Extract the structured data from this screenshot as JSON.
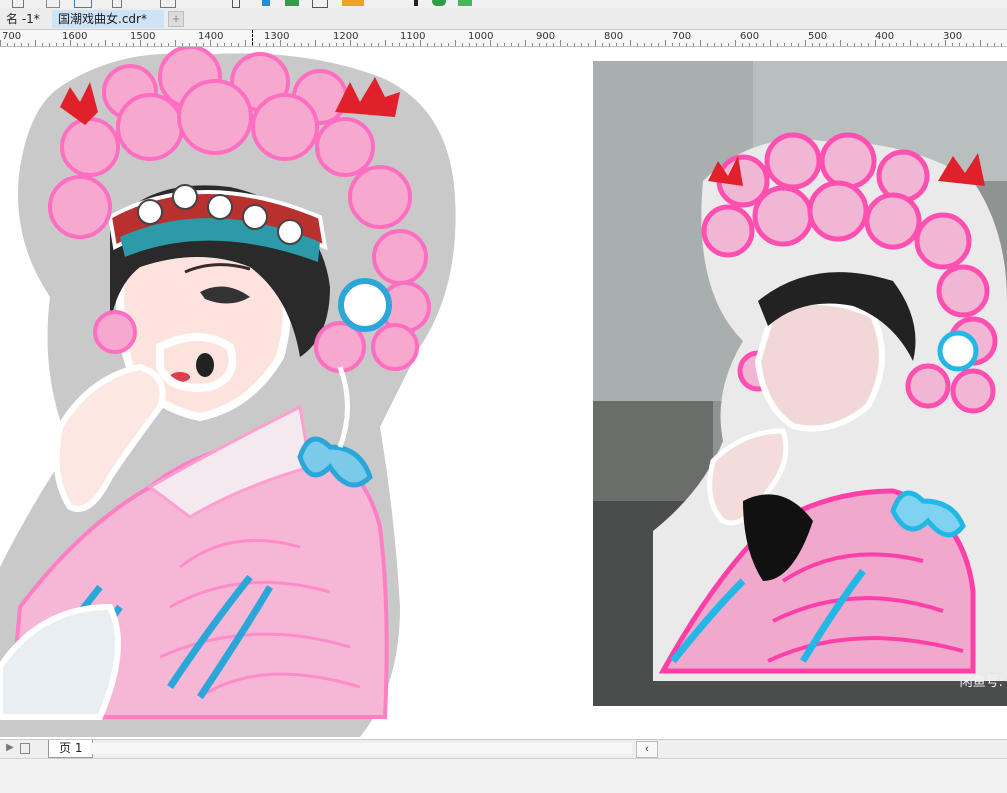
{
  "tabs": [
    {
      "label": "名 -1*",
      "active": false
    },
    {
      "label": "国潮戏曲女.cdr*",
      "active": true
    }
  ],
  "tab_add_label": "+",
  "ruler": {
    "labels": [
      "700",
      "1600",
      "1500",
      "1400",
      "1300",
      "1200",
      "1100",
      "1000",
      "900",
      "800",
      "700",
      "600",
      "500",
      "400",
      "300"
    ]
  },
  "page_tab": {
    "label": "页 1"
  },
  "scroll_arrow": "‹",
  "photo_watermark": "闲鱼号: ",
  "colors": {
    "tab_active": "#cfe3f6",
    "artwork_pink": "#f7a8cf",
    "artwork_magenta": "#ff5fb8",
    "artwork_cyan": "#2aa6d9",
    "outline_gray": "#c9c9c9"
  },
  "icons": [
    "toolbar-icons",
    "add-tab-icon",
    "first-page-icon",
    "add-page-icon",
    "scroll-left-icon"
  ]
}
